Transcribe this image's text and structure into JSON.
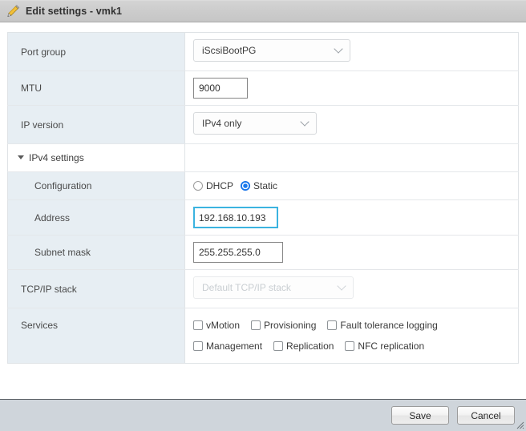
{
  "window": {
    "title": "Edit settings - vmk1",
    "icon": "pencil-icon"
  },
  "form": {
    "rows": [
      {
        "label": "Port group",
        "control": "select",
        "value": "iScsiBootPG"
      },
      {
        "label": "MTU",
        "control": "textinput",
        "value": "9000"
      },
      {
        "label": "IP version",
        "control": "select",
        "value": "IPv4 only"
      },
      {
        "label": "IPv4 settings",
        "control": "section"
      },
      {
        "label": "Configuration",
        "control": "radio"
      },
      {
        "label": "Address",
        "control": "textinput",
        "value": "192.168.10.193"
      },
      {
        "label": "Subnet mask",
        "control": "textinput",
        "value": "255.255.255.0"
      },
      {
        "label": "TCP/IP stack",
        "control": "select",
        "value": "Default TCP/IP stack"
      },
      {
        "label": "Services",
        "control": "checkboxes"
      }
    ],
    "port_group": {
      "label": "Port group",
      "value": "iScsiBootPG"
    },
    "mtu": {
      "label": "MTU",
      "value": "9000"
    },
    "ip_version": {
      "label": "IP version",
      "value": "IPv4 only"
    },
    "ipv4_section": {
      "label": "IPv4 settings",
      "expanded": true
    },
    "configuration": {
      "label": "Configuration",
      "options": [
        {
          "label": "DHCP",
          "selected": false
        },
        {
          "label": "Static",
          "selected": true
        }
      ]
    },
    "address": {
      "label": "Address",
      "value": "192.168.10.193",
      "focused": true
    },
    "subnet_mask": {
      "label": "Subnet mask",
      "value": "255.255.255.0"
    },
    "tcpip_stack": {
      "label": "TCP/IP stack",
      "value": "Default TCP/IP stack",
      "disabled": true
    },
    "services": {
      "label": "Services",
      "row1": [
        {
          "label": "vMotion",
          "checked": false
        },
        {
          "label": "Provisioning",
          "checked": false
        },
        {
          "label": "Fault tolerance logging",
          "checked": false
        }
      ],
      "row2": [
        {
          "label": "Management",
          "checked": false
        },
        {
          "label": "Replication",
          "checked": false
        },
        {
          "label": "NFC replication",
          "checked": false
        }
      ]
    }
  },
  "footer": {
    "save_label": "Save",
    "cancel_label": "Cancel"
  },
  "colors": {
    "label_cell_bg": "#e7eef3",
    "focus_border": "#3bb3e0",
    "radio_accent": "#1a79ec",
    "titlebar_bg": "#cccccc",
    "footer_bg": "#cfd5db"
  }
}
